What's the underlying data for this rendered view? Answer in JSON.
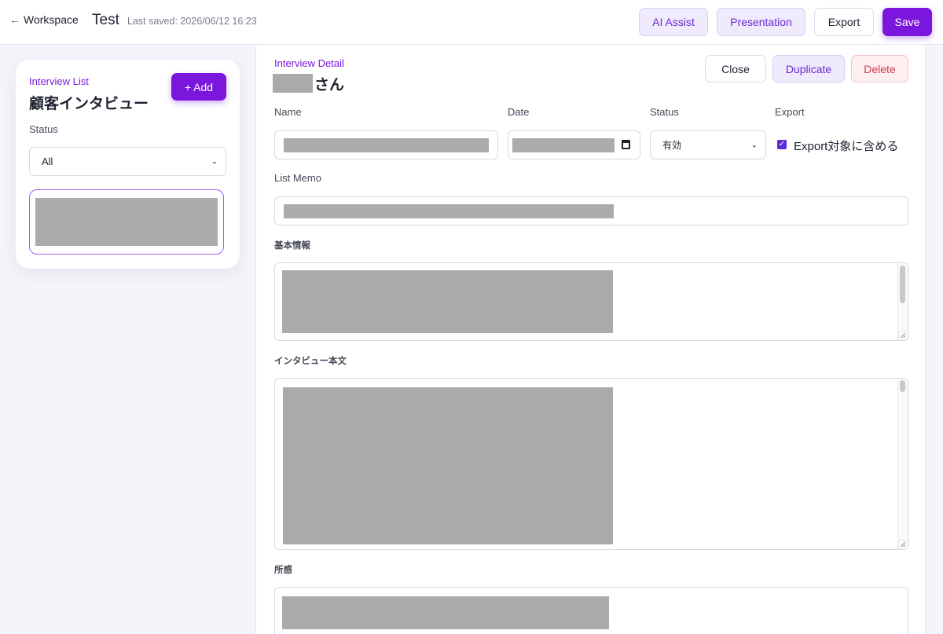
{
  "topbar": {
    "back_label": "Workspace",
    "back_arrow": "←",
    "title": "Test",
    "saved": "Last saved: 2026/06/12 16:23",
    "buttons": {
      "ai_assist": "AI Assist",
      "presentation": "Presentation",
      "export": "Export",
      "save": "Save"
    }
  },
  "sidebar": {
    "eyebrow": "Interview List",
    "title": "顧客インタビュー",
    "add_label": "+ Add",
    "status_label": "Status",
    "status_value": "All"
  },
  "detail": {
    "eyebrow": "Interview Detail",
    "name_suffix": "さん",
    "buttons": {
      "close": "Close",
      "duplicate": "Duplicate",
      "delete": "Delete"
    },
    "fields": {
      "name_label": "Name",
      "date_label": "Date",
      "status_label": "Status",
      "status_value": "有効",
      "export_label": "Export",
      "export_checkbox_label": "Export対象に含める",
      "export_checked": true,
      "memo_label": "List Memo",
      "basic_info_label": "基本情報",
      "interview_body_label": "インタビュー本文",
      "impressions_label": "所感"
    }
  },
  "colors": {
    "accent": "#7b16dd",
    "accent_soft": "#efeafc",
    "danger": "#d2394d",
    "redaction": "#ababab"
  }
}
